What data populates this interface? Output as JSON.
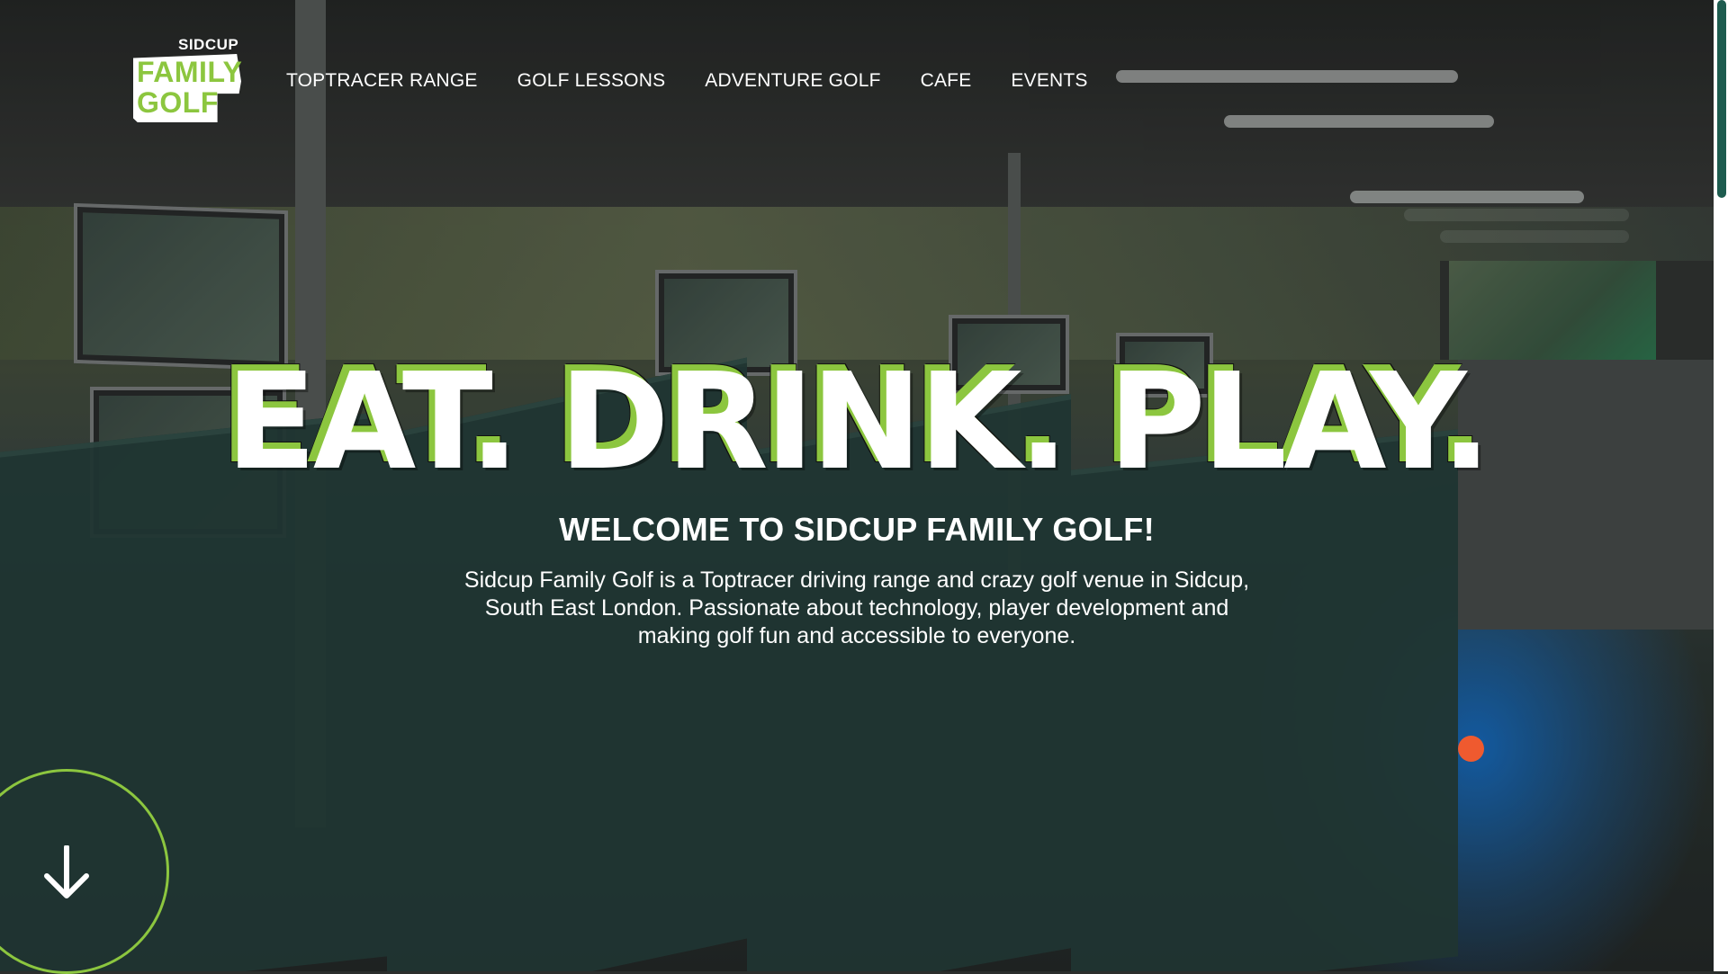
{
  "header": {
    "logo": {
      "top": "SIDCUP",
      "line1": "FAMILY",
      "line2": "GOLF"
    },
    "nav": [
      {
        "label": "TOPTRACER RANGE"
      },
      {
        "label": "GOLF LESSONS"
      },
      {
        "label": "ADVENTURE GOLF"
      },
      {
        "label": "CAFE"
      },
      {
        "label": "EVENTS"
      }
    ]
  },
  "hero": {
    "headline": "EAT. DRINK. PLAY.",
    "welcome": "WELCOME TO SIDCUP FAMILY GOLF!",
    "intro": "Sidcup Family Golf is a Toptracer driving range and crazy golf venue in Sidcup, South East London. Passionate about technology, player development and making golf fun and accessible to everyone.",
    "scroll_icon": "arrow-down-icon"
  },
  "colors": {
    "brand_green": "#8cc63f",
    "accent_orange": "#ef5a2f",
    "glow_blue": "#1478dc",
    "scroll_thumb": "#1e5c4f"
  }
}
